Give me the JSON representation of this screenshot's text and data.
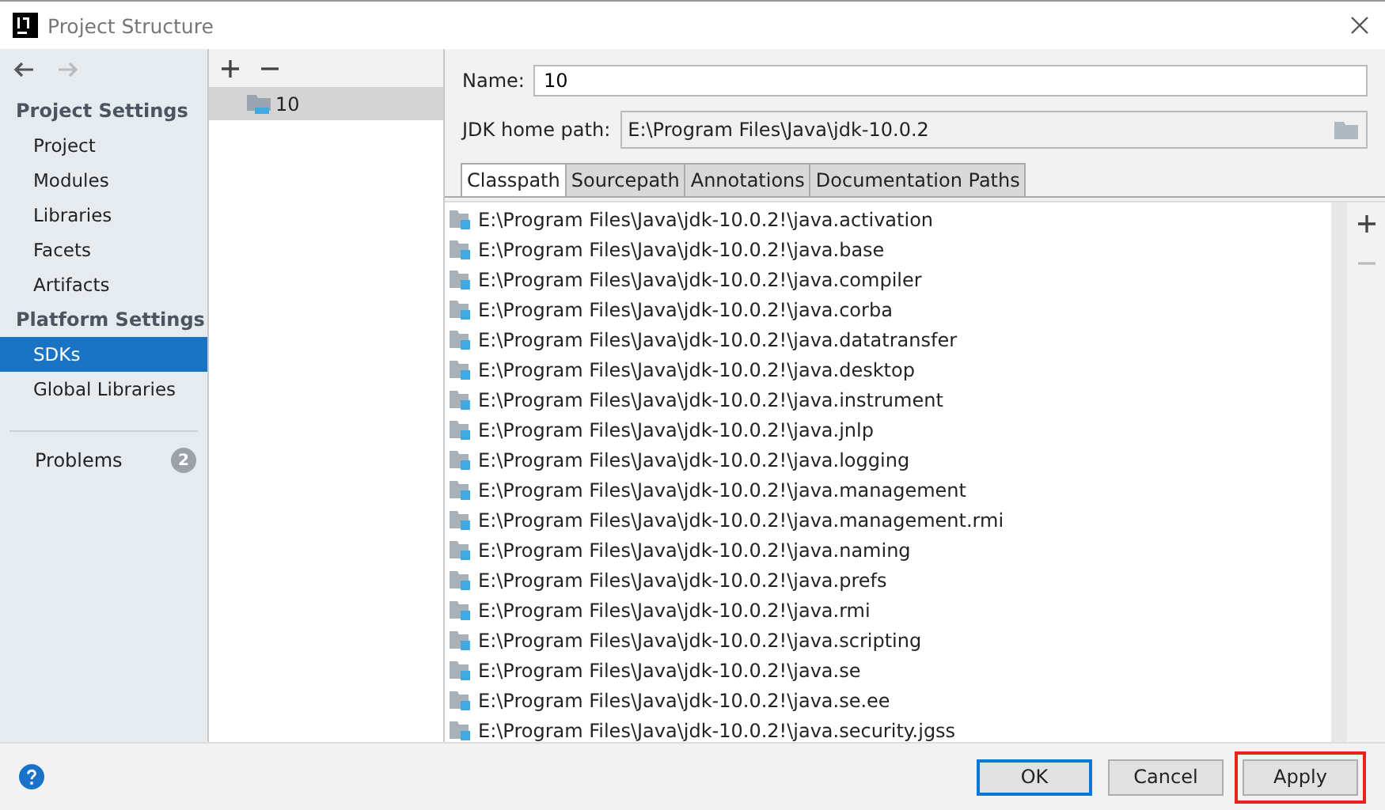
{
  "window": {
    "title": "Project Structure"
  },
  "sidebar": {
    "sections": [
      {
        "heading": "Project Settings",
        "items": [
          {
            "label": "Project",
            "selected": false
          },
          {
            "label": "Modules",
            "selected": false
          },
          {
            "label": "Libraries",
            "selected": false
          },
          {
            "label": "Facets",
            "selected": false
          },
          {
            "label": "Artifacts",
            "selected": false
          }
        ]
      },
      {
        "heading": "Platform Settings",
        "items": [
          {
            "label": "SDKs",
            "selected": true
          },
          {
            "label": "Global Libraries",
            "selected": false
          }
        ]
      }
    ],
    "problems": {
      "label": "Problems",
      "count": "2"
    }
  },
  "sdk_list": {
    "items": [
      {
        "label": "10",
        "selected": true
      }
    ]
  },
  "name_field": {
    "label": "Name:",
    "value": "10"
  },
  "jdk_home_field": {
    "label": "JDK home path:",
    "value": "E:\\Program Files\\Java\\jdk-10.0.2"
  },
  "tabs": [
    {
      "label": "Classpath",
      "selected": true
    },
    {
      "label": "Sourcepath",
      "selected": false
    },
    {
      "label": "Annotations",
      "selected": false
    },
    {
      "label": "Documentation Paths",
      "selected": false
    }
  ],
  "classpath": [
    "E:\\Program Files\\Java\\jdk-10.0.2!\\java.activation",
    "E:\\Program Files\\Java\\jdk-10.0.2!\\java.base",
    "E:\\Program Files\\Java\\jdk-10.0.2!\\java.compiler",
    "E:\\Program Files\\Java\\jdk-10.0.2!\\java.corba",
    "E:\\Program Files\\Java\\jdk-10.0.2!\\java.datatransfer",
    "E:\\Program Files\\Java\\jdk-10.0.2!\\java.desktop",
    "E:\\Program Files\\Java\\jdk-10.0.2!\\java.instrument",
    "E:\\Program Files\\Java\\jdk-10.0.2!\\java.jnlp",
    "E:\\Program Files\\Java\\jdk-10.0.2!\\java.logging",
    "E:\\Program Files\\Java\\jdk-10.0.2!\\java.management",
    "E:\\Program Files\\Java\\jdk-10.0.2!\\java.management.rmi",
    "E:\\Program Files\\Java\\jdk-10.0.2!\\java.naming",
    "E:\\Program Files\\Java\\jdk-10.0.2!\\java.prefs",
    "E:\\Program Files\\Java\\jdk-10.0.2!\\java.rmi",
    "E:\\Program Files\\Java\\jdk-10.0.2!\\java.scripting",
    "E:\\Program Files\\Java\\jdk-10.0.2!\\java.se",
    "E:\\Program Files\\Java\\jdk-10.0.2!\\java.se.ee",
    "E:\\Program Files\\Java\\jdk-10.0.2!\\java.security.jgss"
  ],
  "buttons": [
    {
      "label": "OK",
      "kind": "default",
      "highlighted": false
    },
    {
      "label": "Cancel",
      "kind": "normal",
      "highlighted": false
    },
    {
      "label": "Apply",
      "kind": "normal",
      "highlighted": true
    }
  ]
}
